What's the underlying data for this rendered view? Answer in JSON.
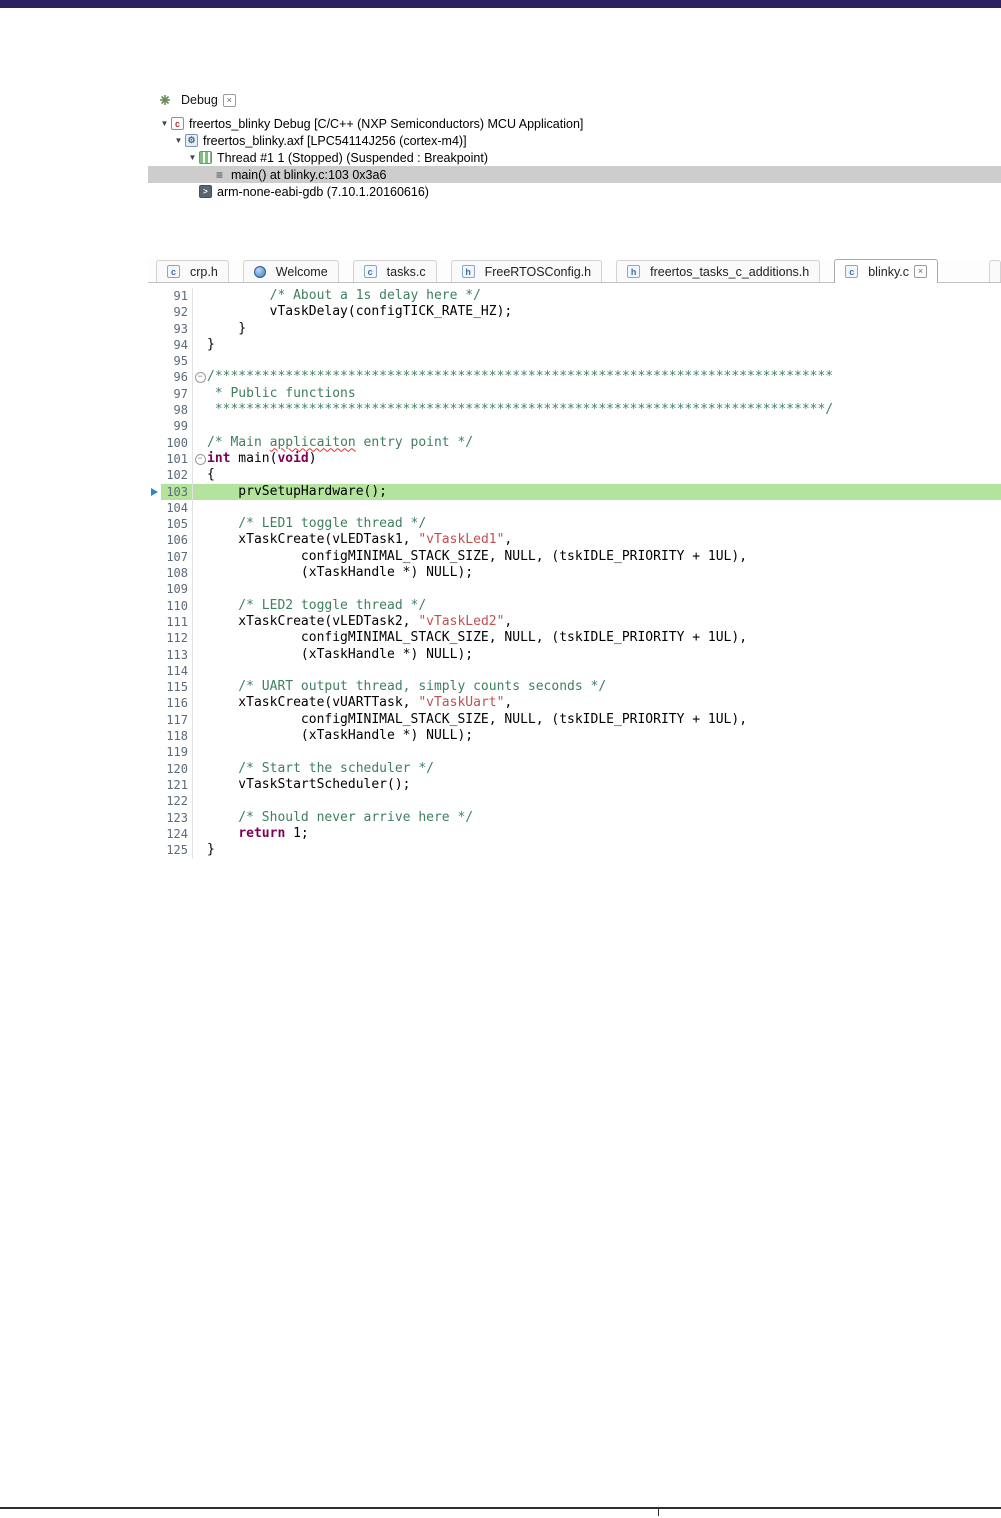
{
  "colors": {
    "top_bar": "#2c2161",
    "selection_bg": "#cdcdcd",
    "current_line_bg": "#b4e39e",
    "plain": "#000000",
    "comment": "#3f7f5f",
    "keyword": "#7f0055",
    "string": "#c05050",
    "line_number": "#5b6b7c"
  },
  "glyphs": {
    "close": "×",
    "triangle": "▼",
    "fold": "−"
  },
  "icons": {
    "debug-view-icon": {
      "style": "asterisk"
    },
    "c-application-icon": {
      "letter": "c"
    },
    "executable-icon": {
      "glyph": "⚙"
    },
    "thread-icon": {
      "letter": ""
    },
    "stack-frame-icon": {
      "glyph": "≡"
    },
    "gdb-icon": {
      "letter": ">"
    },
    "globe-icon": {
      "letter": ""
    },
    "c-file-icon": {
      "letter": "c"
    },
    "h-file-icon": {
      "letter": "h"
    }
  },
  "debug_view": {
    "tab_label": "Debug",
    "tree": [
      {
        "level": 0,
        "expanded": true,
        "selected": false,
        "icon": "c-application-icon",
        "label": "freertos_blinky Debug [C/C++ (NXP Semiconductors) MCU Application]"
      },
      {
        "level": 1,
        "expanded": true,
        "selected": false,
        "icon": "executable-icon",
        "label": "freertos_blinky.axf [LPC54114J256 (cortex-m4)]"
      },
      {
        "level": 2,
        "expanded": true,
        "selected": false,
        "icon": "thread-icon",
        "label": "Thread #1 1 (Stopped) (Suspended : Breakpoint)"
      },
      {
        "level": 3,
        "expanded": null,
        "selected": true,
        "icon": "stack-frame-icon",
        "label": "main() at blinky.c:103 0x3a6"
      },
      {
        "level": 2,
        "expanded": null,
        "selected": false,
        "icon": "gdb-icon",
        "label": "arm-none-eabi-gdb (7.10.1.20160616)"
      }
    ]
  },
  "editor": {
    "tabs": [
      {
        "label": "crp.h",
        "icon": "c-file-icon",
        "active": false,
        "closable": false
      },
      {
        "label": "Welcome",
        "icon": "globe-icon",
        "active": false,
        "closable": false
      },
      {
        "label": "tasks.c",
        "icon": "c-file-icon",
        "active": false,
        "closable": false
      },
      {
        "label": "FreeRTOSConfig.h",
        "icon": "h-file-icon",
        "active": false,
        "closable": false
      },
      {
        "label": "freertos_tasks_c_additions.h",
        "icon": "h-file-icon",
        "active": false,
        "closable": false
      },
      {
        "label": "blinky.c",
        "icon": "c-file-icon",
        "active": true,
        "closable": true
      }
    ],
    "tab_overflow_sliver": true,
    "code": {
      "current_line": 103,
      "lines": [
        {
          "n": 91,
          "seg": [
            [
              "comment",
              "        /* About a 1s delay here */"
            ]
          ]
        },
        {
          "n": 92,
          "seg": [
            [
              "plain",
              "        vTaskDelay(configTICK_RATE_HZ);"
            ]
          ]
        },
        {
          "n": 93,
          "seg": [
            [
              "plain",
              "    }"
            ]
          ]
        },
        {
          "n": 94,
          "seg": [
            [
              "plain",
              "}"
            ]
          ]
        },
        {
          "n": 95,
          "seg": []
        },
        {
          "n": 96,
          "fold": true,
          "seg": [
            [
              "comment",
              "/*******************************************************************************"
            ]
          ]
        },
        {
          "n": 97,
          "seg": [
            [
              "comment",
              " * Public functions"
            ]
          ]
        },
        {
          "n": 98,
          "seg": [
            [
              "comment",
              " ******************************************************************************/"
            ]
          ]
        },
        {
          "n": 99,
          "seg": []
        },
        {
          "n": 100,
          "seg": [
            [
              "comment",
              "/* Main "
            ],
            [
              "comment-err",
              "applicaiton"
            ],
            [
              "comment",
              " entry point */"
            ]
          ]
        },
        {
          "n": 101,
          "fold": true,
          "seg": [
            [
              "keyword",
              "int"
            ],
            [
              "plain",
              " main("
            ],
            [
              "keyword",
              "void"
            ],
            [
              "plain",
              ")"
            ]
          ]
        },
        {
          "n": 102,
          "seg": [
            [
              "plain",
              "{"
            ]
          ]
        },
        {
          "n": 103,
          "pointer": true,
          "seg": [
            [
              "plain",
              "    prvSetupHardware();"
            ]
          ]
        },
        {
          "n": 104,
          "seg": []
        },
        {
          "n": 105,
          "seg": [
            [
              "comment",
              "    /* LED1 toggle thread */"
            ]
          ]
        },
        {
          "n": 106,
          "seg": [
            [
              "plain",
              "    xTaskCreate(vLEDTask1, "
            ],
            [
              "string",
              "\"vTaskLed1\""
            ],
            [
              "plain",
              ","
            ]
          ]
        },
        {
          "n": 107,
          "seg": [
            [
              "plain",
              "            configMINIMAL_STACK_SIZE, NULL, (tskIDLE_PRIORITY + 1UL),"
            ]
          ]
        },
        {
          "n": 108,
          "seg": [
            [
              "plain",
              "            (xTaskHandle *) NULL);"
            ]
          ]
        },
        {
          "n": 109,
          "seg": []
        },
        {
          "n": 110,
          "seg": [
            [
              "comment",
              "    /* LED2 toggle thread */"
            ]
          ]
        },
        {
          "n": 111,
          "seg": [
            [
              "plain",
              "    xTaskCreate(vLEDTask2, "
            ],
            [
              "string",
              "\"vTaskLed2\""
            ],
            [
              "plain",
              ","
            ]
          ]
        },
        {
          "n": 112,
          "seg": [
            [
              "plain",
              "            configMINIMAL_STACK_SIZE, NULL, (tskIDLE_PRIORITY + 1UL),"
            ]
          ]
        },
        {
          "n": 113,
          "seg": [
            [
              "plain",
              "            (xTaskHandle *) NULL);"
            ]
          ]
        },
        {
          "n": 114,
          "seg": []
        },
        {
          "n": 115,
          "seg": [
            [
              "comment",
              "    /* UART output thread, simply counts seconds */"
            ]
          ]
        },
        {
          "n": 116,
          "seg": [
            [
              "plain",
              "    xTaskCreate(vUARTTask, "
            ],
            [
              "string",
              "\"vTaskUart\""
            ],
            [
              "plain",
              ","
            ]
          ]
        },
        {
          "n": 117,
          "seg": [
            [
              "plain",
              "            configMINIMAL_STACK_SIZE, NULL, (tskIDLE_PRIORITY + 1UL),"
            ]
          ]
        },
        {
          "n": 118,
          "seg": [
            [
              "plain",
              "            (xTaskHandle *) NULL);"
            ]
          ]
        },
        {
          "n": 119,
          "seg": []
        },
        {
          "n": 120,
          "seg": [
            [
              "comment",
              "    /* Start the scheduler */"
            ]
          ]
        },
        {
          "n": 121,
          "seg": [
            [
              "plain",
              "    vTaskStartScheduler();"
            ]
          ]
        },
        {
          "n": 122,
          "seg": []
        },
        {
          "n": 123,
          "seg": [
            [
              "comment",
              "    /* Should never arrive here */"
            ]
          ]
        },
        {
          "n": 124,
          "seg": [
            [
              "plain",
              "    "
            ],
            [
              "keyword",
              "return"
            ],
            [
              "plain",
              " 1;"
            ]
          ]
        },
        {
          "n": 125,
          "seg": [
            [
              "plain",
              "}"
            ]
          ]
        }
      ]
    }
  }
}
